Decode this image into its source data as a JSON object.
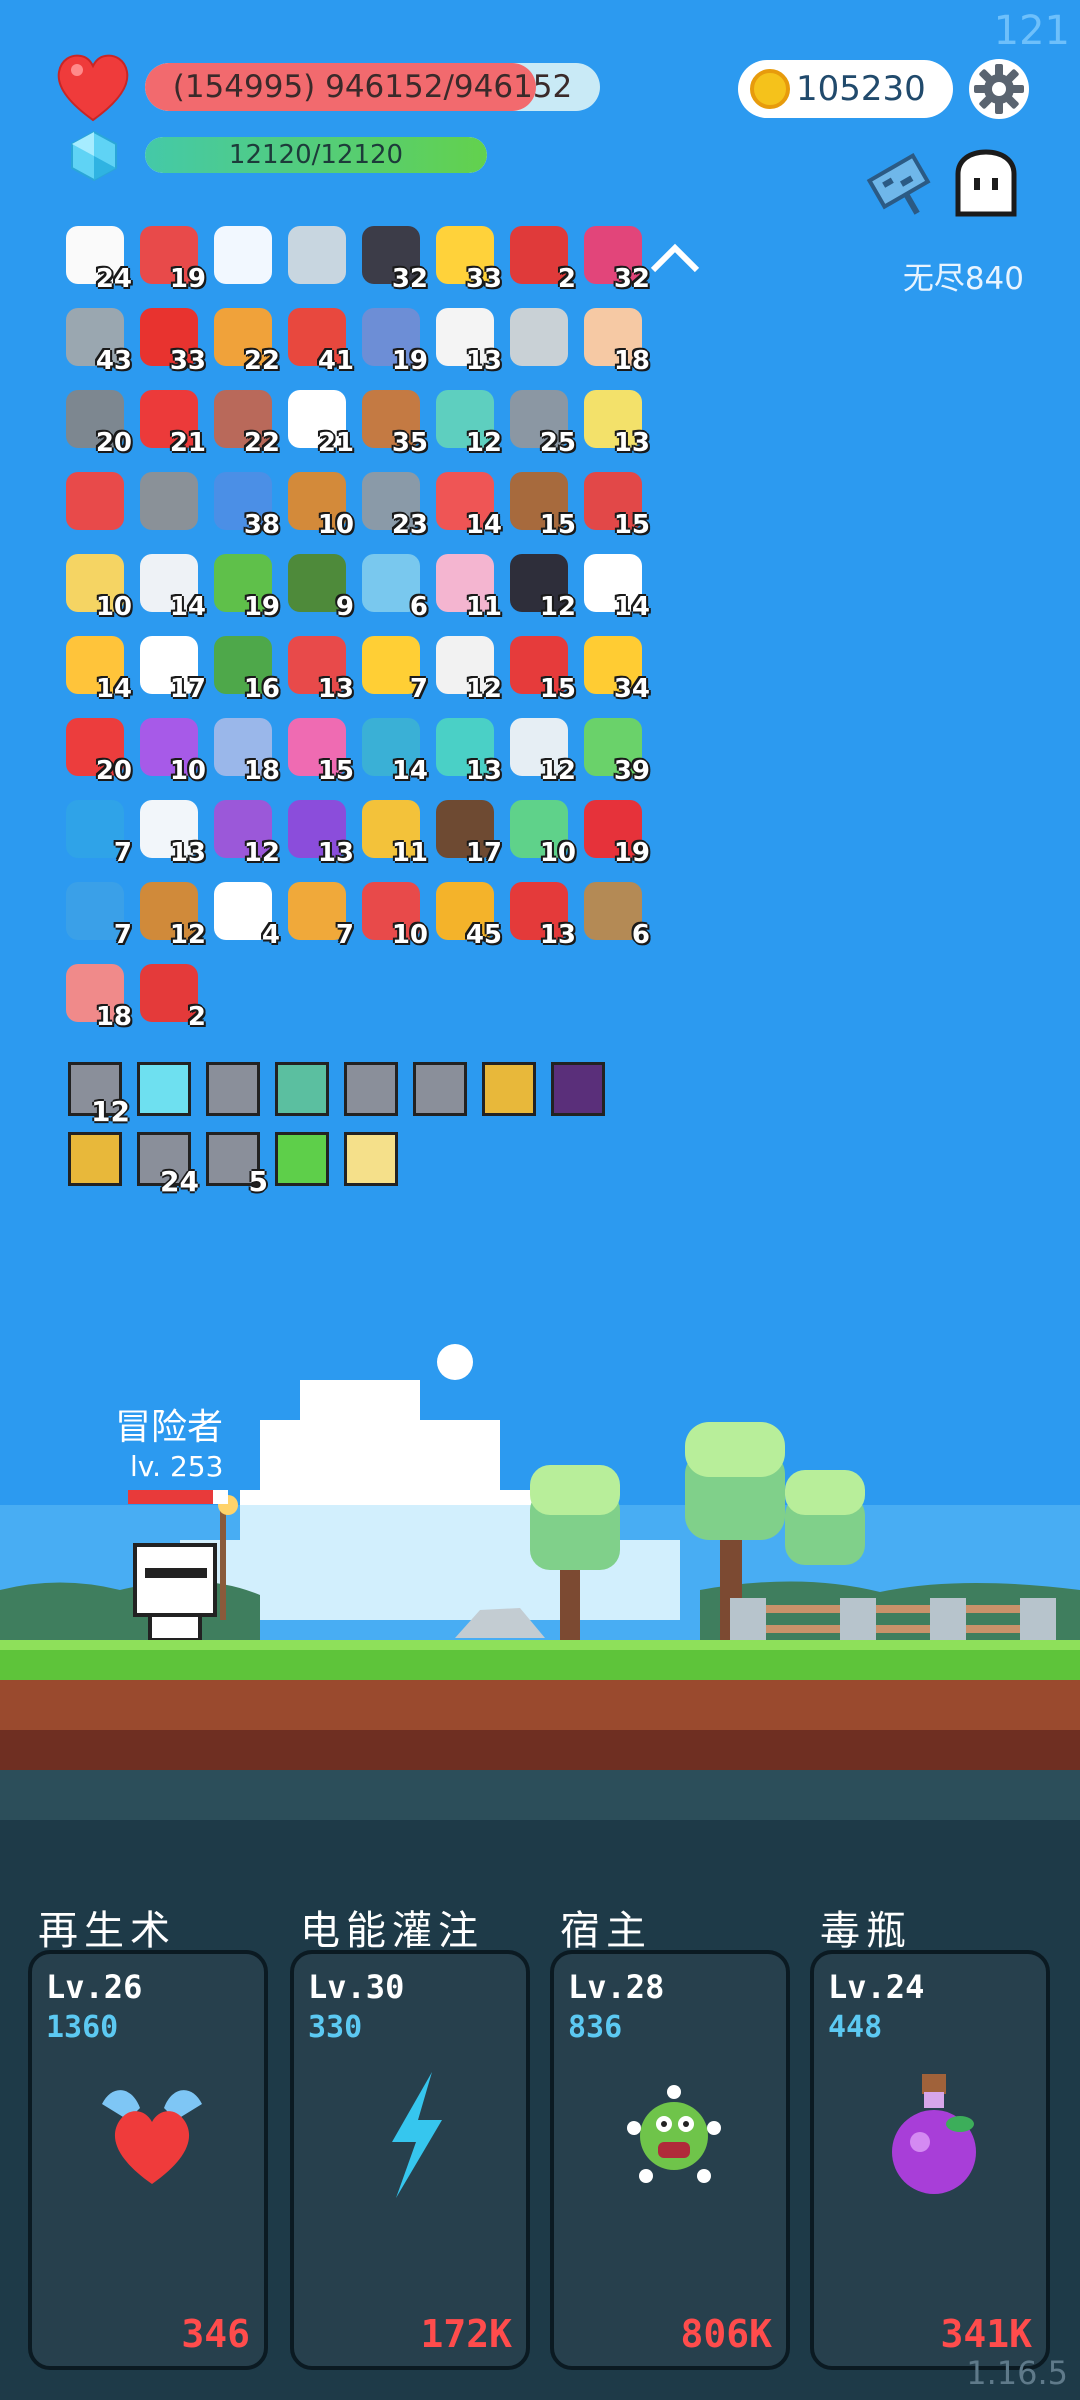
{
  "frame_counter": "121",
  "version": "1.16.5",
  "hud": {
    "hp_text": "(154995) 946152/946152",
    "hp_fraction": 0.86,
    "mana_text": "12120/12120",
    "mana_fraction": 1.0,
    "gold": "105230",
    "mode_label": "无尽840"
  },
  "inventory": [
    {
      "icon": "flower-icon",
      "count": "24",
      "color": "#fafafa"
    },
    {
      "icon": "sock-icon",
      "count": "19",
      "color": "#e84a4a"
    },
    {
      "icon": "wing-icon",
      "count": "",
      "color": "#f2f8ff"
    },
    {
      "icon": "sword-icon",
      "count": "",
      "color": "#c8d6e0"
    },
    {
      "icon": "bat-icon",
      "count": "32",
      "color": "#3c3c48"
    },
    {
      "icon": "sun-icon",
      "count": "33",
      "color": "#ffd23a"
    },
    {
      "icon": "magnet-icon",
      "count": "2",
      "color": "#e03a3a"
    },
    {
      "icon": "jam-jar-icon",
      "count": "32",
      "color": "#e2457a"
    },
    {
      "icon": "dagger-icon",
      "count": "43",
      "color": "#9aa7b0"
    },
    {
      "icon": "apple-icon",
      "count": "33",
      "color": "#e8332f"
    },
    {
      "icon": "book-icon",
      "count": "22",
      "color": "#f0a23a"
    },
    {
      "icon": "watermelon-icon",
      "count": "41",
      "color": "#e8483e"
    },
    {
      "icon": "shield-icon",
      "count": "19",
      "color": "#6d8ed6"
    },
    {
      "icon": "dice-icon",
      "count": "13",
      "color": "#f4f4f4"
    },
    {
      "icon": "hook-icon",
      "count": "",
      "color": "#c9d1d6"
    },
    {
      "icon": "hand-icon",
      "count": "18",
      "color": "#f6c9a4"
    },
    {
      "icon": "spiked-ball-icon",
      "count": "20",
      "color": "#7d8790"
    },
    {
      "icon": "heart-icon",
      "count": "21",
      "color": "#ec3a3a"
    },
    {
      "icon": "tombstone-icon",
      "count": "22",
      "color": "#b9695a"
    },
    {
      "icon": "fried-egg-icon",
      "count": "21",
      "color": "#ffffff"
    },
    {
      "icon": "donut-icon",
      "count": "35",
      "color": "#c47a43"
    },
    {
      "icon": "ring-icon",
      "count": "12",
      "color": "#5ecfbf"
    },
    {
      "icon": "elephant-icon",
      "count": "25",
      "color": "#8b97a3"
    },
    {
      "icon": "halo-icon",
      "count": "13",
      "color": "#f3e16a"
    },
    {
      "icon": "percent-card-icon",
      "count": "",
      "color": "#e84a4a"
    },
    {
      "icon": "helmet-icon",
      "count": "",
      "color": "#8a9198"
    },
    {
      "icon": "star-card-icon",
      "count": "38",
      "color": "#4b8fe6"
    },
    {
      "icon": "crossbow-icon",
      "count": "10",
      "color": "#d38a3a"
    },
    {
      "icon": "compass-icon",
      "count": "23",
      "color": "#8a9aa8"
    },
    {
      "icon": "pill-icon",
      "count": "14",
      "color": "#ef5555"
    },
    {
      "icon": "coconut-drink-icon",
      "count": "15",
      "color": "#a76a3d"
    },
    {
      "icon": "red-shield-icon",
      "count": "15",
      "color": "#e24848"
    },
    {
      "icon": "note-icon",
      "count": "10",
      "color": "#f5d463"
    },
    {
      "icon": "envelope-icon",
      "count": "14",
      "color": "#eef2f6"
    },
    {
      "icon": "frog-icon",
      "count": "19",
      "color": "#5fc04a"
    },
    {
      "icon": "grenade-icon",
      "count": "9",
      "color": "#4e8a3a"
    },
    {
      "icon": "flask-icon",
      "count": "6",
      "color": "#79c8ee"
    },
    {
      "icon": "ice-cream-icon",
      "count": "11",
      "color": "#f4b5d0"
    },
    {
      "icon": "cauldron-icon",
      "count": "12",
      "color": "#2e2e3a"
    },
    {
      "icon": "ghost-item-icon",
      "count": "14",
      "color": "#ffffff"
    },
    {
      "icon": "sunflower-icon",
      "count": "14",
      "color": "#ffc43a"
    },
    {
      "icon": "cloud-icon",
      "count": "17",
      "color": "#ffffff"
    },
    {
      "icon": "turtle-shell-icon",
      "count": "16",
      "color": "#4ea84a"
    },
    {
      "icon": "thermometer-icon",
      "count": "13",
      "color": "#e84a4a"
    },
    {
      "icon": "magic-wand-icon",
      "count": "7",
      "color": "#ffcf35"
    },
    {
      "icon": "playing-card-icon",
      "count": "12",
      "color": "#f2f2f2"
    },
    {
      "icon": "mushroom-icon",
      "count": "15",
      "color": "#e63b3b"
    },
    {
      "icon": "crown-icon",
      "count": "34",
      "color": "#ffcc33"
    },
    {
      "icon": "gift-icon",
      "count": "20",
      "color": "#ec3d3d"
    },
    {
      "icon": "crystal-ball-icon",
      "count": "10",
      "color": "#a75ae8"
    },
    {
      "icon": "capsule-icon",
      "count": "18",
      "color": "#9ab7ea"
    },
    {
      "icon": "potion-bottle-icon",
      "count": "15",
      "color": "#ef6bb2"
    },
    {
      "icon": "target-icon",
      "count": "14",
      "color": "#3ab0d6"
    },
    {
      "icon": "scroll-icon",
      "count": "13",
      "color": "#4ad0c6"
    },
    {
      "icon": "lightbulb-icon",
      "count": "12",
      "color": "#e6eef4"
    },
    {
      "icon": "money-heart-icon",
      "count": "39",
      "color": "#6ad26a"
    },
    {
      "icon": "gem-icon",
      "count": "7",
      "color": "#2fa3e8"
    },
    {
      "icon": "clipboard-icon",
      "count": "13",
      "color": "#f2f6fa"
    },
    {
      "icon": "star-shield-icon",
      "count": "12",
      "color": "#9b58d9"
    },
    {
      "icon": "purple-box-icon",
      "count": "13",
      "color": "#8b4ddb"
    },
    {
      "icon": "gold-ring-icon",
      "count": "11",
      "color": "#f3c23a"
    },
    {
      "icon": "coconut-icon",
      "count": "17",
      "color": "#6e4a32"
    },
    {
      "icon": "green-blob-icon",
      "count": "10",
      "color": "#5fd28a"
    },
    {
      "icon": "strawberry-icon",
      "count": "19",
      "color": "#e6323a"
    },
    {
      "icon": "speech-bubble-icon",
      "count": "7",
      "color": "#3aa0e8"
    },
    {
      "icon": "meteor-icon",
      "count": "12",
      "color": "#d08a3a"
    },
    {
      "icon": "chat-icon",
      "count": "4",
      "color": "#ffffff"
    },
    {
      "icon": "parchment-icon",
      "count": "7",
      "color": "#f0a93a"
    },
    {
      "icon": "bell-pull-icon",
      "count": "10",
      "color": "#e84a4a"
    },
    {
      "icon": "coins-stack-icon",
      "count": "45",
      "color": "#f4b32a"
    },
    {
      "icon": "red-flag-icon",
      "count": "13",
      "color": "#e43a3a"
    },
    {
      "icon": "noose-icon",
      "count": "6",
      "color": "#b48a55"
    },
    {
      "icon": "meat-icon",
      "count": "18",
      "color": "#f08a8a"
    },
    {
      "icon": "double-heart-icon",
      "count": "2",
      "color": "#e43a3a"
    }
  ],
  "relics": [
    {
      "icon": "claw-relic-icon",
      "count": "12",
      "color": "#8a8f9a"
    },
    {
      "icon": "glow-relic-icon",
      "count": "",
      "color": "#6ee0f0"
    },
    {
      "icon": "claw-relic-icon",
      "count": "",
      "color": "#8a8f9a"
    },
    {
      "icon": "skull-relic-icon",
      "count": "",
      "color": "#5bbfa0"
    },
    {
      "icon": "claw-relic-icon",
      "count": "",
      "color": "#8a8f9a"
    },
    {
      "icon": "claw-relic-icon",
      "count": "",
      "color": "#8a8f9a"
    },
    {
      "icon": "shield-relic-icon",
      "count": "",
      "color": "#e8b83a"
    },
    {
      "icon": "demon-relic-icon",
      "count": "",
      "color": "#5a2f7a"
    },
    {
      "icon": "shield-relic-icon",
      "count": "",
      "color": "#e8b83a"
    },
    {
      "icon": "claw-relic-icon",
      "count": "24",
      "color": "#8a8f9a"
    },
    {
      "icon": "claw-relic-icon",
      "count": "5",
      "color": "#8a8f9a"
    },
    {
      "icon": "check-relic-icon",
      "count": "",
      "color": "#5ecf4a"
    },
    {
      "icon": "burst-relic-icon",
      "count": "",
      "color": "#f5e08a"
    }
  ],
  "player": {
    "name": "冒险者",
    "level": "lv. 253",
    "hp_fraction": 0.85
  },
  "skills": [
    {
      "name": "再生术",
      "level": "Lv.26",
      "cost": "1360",
      "dps": "346",
      "icon": "winged-heart-icon"
    },
    {
      "name": "电能灌注",
      "level": "Lv.30",
      "cost": "330",
      "dps": "172K",
      "icon": "lightning-icon"
    },
    {
      "name": "宿主",
      "level": "Lv.28",
      "cost": "836",
      "dps": "806K",
      "icon": "green-monster-icon"
    },
    {
      "name": "毒瓶",
      "level": "Lv.24",
      "cost": "448",
      "dps": "341K",
      "icon": "poison-bottle-icon"
    }
  ]
}
